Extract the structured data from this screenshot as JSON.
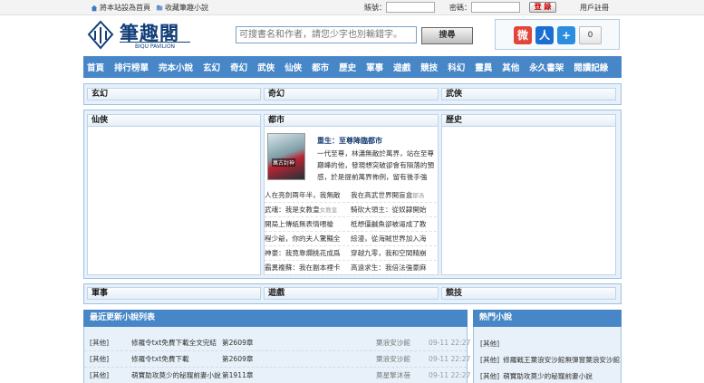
{
  "topbar": {
    "set_home": "將本站設為首頁",
    "bookmark": "收藏筆趣小說",
    "account_label": "賬號：",
    "password_label": "密碼：",
    "login": "登 錄",
    "register": "用戶註冊"
  },
  "header": {
    "logo_title": "筆趣閣",
    "logo_sub": "BIQU PAVILION",
    "search_placeholder": "可搜書名和作者，請您少字也別輸錯字。",
    "search_button": "搜尋",
    "share_count": "0"
  },
  "nav": [
    "首頁",
    "排行榜單",
    "完本小說",
    "玄幻",
    "奇幻",
    "武俠",
    "仙俠",
    "都市",
    "歷史",
    "軍事",
    "遊戲",
    "競技",
    "科幻",
    "靈異",
    "其他",
    "永久書架",
    "閱讀記錄"
  ],
  "sections": {
    "row1": [
      "玄幻",
      "奇幻",
      "武俠"
    ],
    "row2": [
      "仙俠",
      "都市",
      "歷史"
    ],
    "row3": [
      "軍事",
      "遊戲",
      "競技"
    ]
  },
  "featured": {
    "cover_text": "萬古封神",
    "title": "重生：至尊降臨都市",
    "description": "一代至尊，林瀟無敵於萬界，站在至尊巔峰的他，發現想突破卻會有隕落的預感，於是提前萬界佈例，留有後手強"
  },
  "urban_list": [
    {
      "a": "人在亮劍兩年半，我無敵",
      "b": "我在高武世界開盲盒",
      "b_author": "鄒洛"
    },
    {
      "a": "武魂：我是女教皇",
      "a_author": "女教皇",
      "b": "騎砍大領主：從奴隸開始"
    },
    {
      "a": "開局上傳紙無表情喂槍",
      "b": "柢想僵鹹魚卻被逼成了教"
    },
    {
      "a": "程少爺，你的夫人驚豔全",
      "b": "綜漫，從海賊世界加入海"
    },
    {
      "a": "神豪：我竟靠爛桃花成爲",
      "b": "穿越九零，我和空間精崩"
    },
    {
      "a": "霸異複蘇：我在副本裡卡",
      "b": "高遠求生：我倍法強豪麻"
    }
  ],
  "latest": {
    "title": "最近更新小說列表",
    "rows": [
      {
        "cat": "[其他]",
        "book": "修羅令txt免費下載全文完結",
        "chapter": "第2609章",
        "author": "葉浪安沙館",
        "time": "09-11 22:27"
      },
      {
        "cat": "[其他]",
        "book": "修羅令txt免費下載",
        "chapter": "第2609章",
        "author": "葉浪安沙館",
        "time": "09-11 22:27"
      },
      {
        "cat": "[其他]",
        "book": "萌寶助攻莫少的秘寵前妻小說",
        "chapter": "第1911章",
        "author": "莫星擎沐蓓",
        "time": "09-11 22:27"
      }
    ]
  },
  "hot": {
    "title": "熱門小說",
    "rows": [
      {
        "cat": "[其他]",
        "book": ""
      },
      {
        "cat": "[其他]",
        "book": "修羅戰王葉浪安沙館無彈窗",
        "author": "葉浪安沙館"
      },
      {
        "cat": "[其他]",
        "book": "萌寶助攻莫少的秘寵前妻小說"
      }
    ]
  }
}
